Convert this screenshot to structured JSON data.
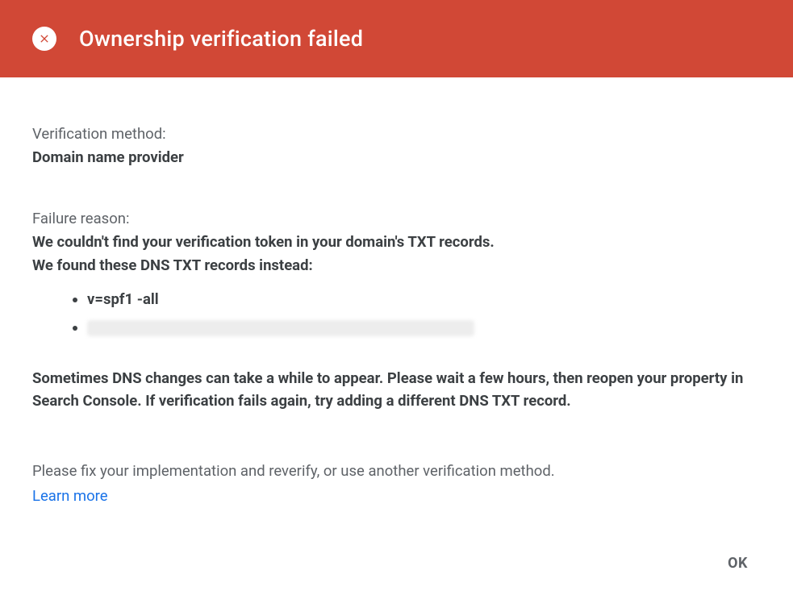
{
  "header": {
    "title": "Ownership verification failed"
  },
  "verification": {
    "label": "Verification method:",
    "value": "Domain name provider"
  },
  "failure": {
    "label": "Failure reason:",
    "line1": "We couldn't find your verification token in your domain's TXT records.",
    "line2": "We found these DNS TXT records instead:",
    "records": [
      "v=spf1 -all"
    ],
    "redacted_records_count": 1
  },
  "dns_note": "Sometimes DNS changes can take a while to appear. Please wait a few hours, then reopen your property in Search Console. If verification fails again, try adding a different DNS TXT record.",
  "fix_note": "Please fix your implementation and reverify, or use another verification method.",
  "learn_more": "Learn more",
  "ok_button": "OK"
}
